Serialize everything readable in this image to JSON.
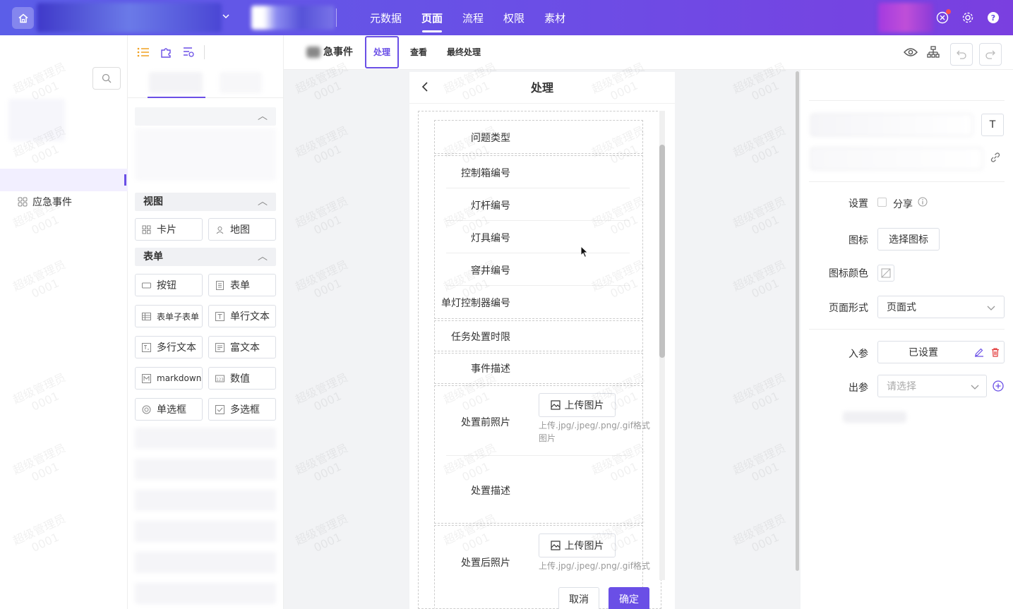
{
  "topnav": {
    "items": [
      {
        "label": "元数据",
        "active": false
      },
      {
        "label": "页面",
        "active": true
      },
      {
        "label": "流程",
        "active": false
      },
      {
        "label": "权限",
        "active": false
      },
      {
        "label": "素材",
        "active": false
      }
    ],
    "colors": {
      "start": "#5b5ee8",
      "end": "#7a3fe0"
    }
  },
  "leftnav": {
    "items": [
      {
        "label": "应急事件",
        "icon": "grid-icon"
      }
    ]
  },
  "palette": {
    "sections": {
      "view": "视图",
      "form": "表单"
    },
    "view_items": [
      {
        "label": "卡片",
        "icon": "card-icon"
      },
      {
        "label": "地图",
        "icon": "map-icon"
      }
    ],
    "form_items": [
      {
        "label": "按钮",
        "icon": "button-icon"
      },
      {
        "label": "表单",
        "icon": "form-icon"
      },
      {
        "label": "表单子表单",
        "icon": "subform-icon"
      },
      {
        "label": "单行文本",
        "icon": "text-icon"
      },
      {
        "label": "多行文本",
        "icon": "textarea-icon"
      },
      {
        "label": "富文本",
        "icon": "richtext-icon"
      },
      {
        "label": "markdown",
        "icon": "markdown-icon"
      },
      {
        "label": "数值",
        "icon": "number-icon"
      },
      {
        "label": "单选框",
        "icon": "radio-icon"
      },
      {
        "label": "多选框",
        "icon": "checkbox-icon"
      }
    ]
  },
  "editor": {
    "page_name": "急事件",
    "tabs": [
      {
        "label": "处理",
        "active": true
      },
      {
        "label": "查看",
        "active": false
      },
      {
        "label": "最终处理",
        "active": false
      }
    ]
  },
  "phone": {
    "title": "处理",
    "fields": [
      "问题类型",
      "控制箱编号",
      "灯杆编号",
      "灯具编号",
      "窨井编号",
      "单灯控制器编号",
      "任务处置时限",
      "事件描述",
      "处置前照片",
      "处置描述",
      "处置后照片"
    ],
    "upload_label": "上传图片",
    "upload_hint": "上传.jpg/.jpeg/.png/.gif格式图片",
    "cancel": "取消",
    "confirm": "确定",
    "accent": "#6a4fe6"
  },
  "props": {
    "setting_label": "设置",
    "share_label": "分享",
    "icon_label": "图标",
    "icon_btn": "选择图标",
    "icon_color_label": "图标颜色",
    "page_form_label": "页面形式",
    "page_form_value": "页面式",
    "in_param_label": "入参",
    "in_param_value": "已设置",
    "out_param_label": "出参",
    "out_param_placeholder": "请选择",
    "text_btn": "T"
  },
  "watermark": {
    "line1": "超级管理员",
    "line2": "0001"
  }
}
